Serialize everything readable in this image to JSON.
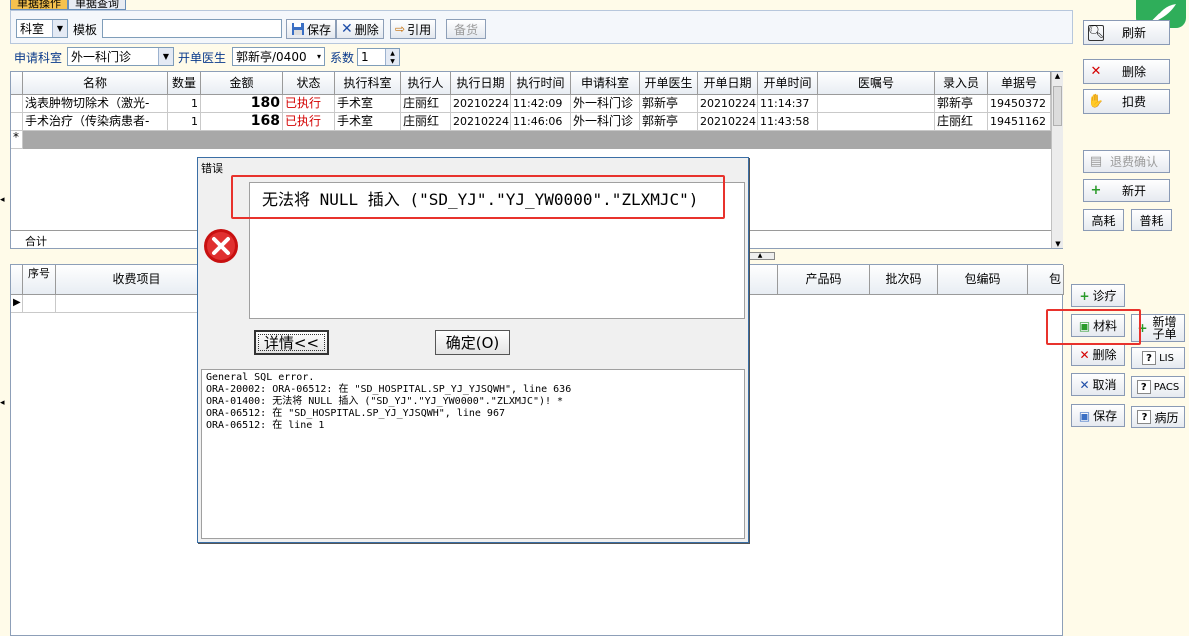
{
  "tabs": [
    "单据操作",
    "单据查询"
  ],
  "toolbar": {
    "dept_select": "科室",
    "template_label": "模板",
    "template_value": "",
    "save": "保存",
    "delete": "删除",
    "cite": "引用",
    "stock": "备货"
  },
  "filter": {
    "apply_dept_label": "申请科室",
    "apply_dept_value": "外一科门诊",
    "doctor_label": "开单医生",
    "doctor_value": "郭新亭/0400",
    "coef_label": "系数",
    "coef_value": "1"
  },
  "grid": {
    "columns": [
      "名称",
      "数量",
      "金额",
      "状态",
      "执行科室",
      "执行人",
      "执行日期",
      "执行时间",
      "申请科室",
      "开单医生",
      "开单日期",
      "开单时间",
      "医嘱号",
      "录入员",
      "单据号"
    ],
    "rows": [
      [
        "浅表肿物切除术（激光-",
        "1",
        "180",
        "已执行",
        "手术室",
        "庄丽红",
        "20210224",
        "11:42:09",
        "外一科门诊",
        "郭新亭",
        "20210224",
        "11:14:37",
        "",
        "郭新亭",
        "19450372"
      ],
      [
        "手术治疗（传染病患者-",
        "1",
        "168",
        "已执行",
        "手术室",
        "庄丽红",
        "20210224",
        "11:46:06",
        "外一科门诊",
        "郭新亭",
        "20210224",
        "11:43:58",
        "",
        "庄丽红",
        "19451162"
      ]
    ],
    "new_row_marker": "*",
    "total_label": "合计"
  },
  "lower_grid": {
    "columns": [
      "序号",
      "收费项目",
      "产品码",
      "批次码",
      "包编码",
      "包"
    ]
  },
  "right_panel": {
    "refresh": "刷新",
    "delete": "删除",
    "deduct": "扣费",
    "refund_confirm": "退费确认",
    "new_open": "新开",
    "high_cons": "高耗",
    "normal_cons": "普耗"
  },
  "right_panel2": {
    "treat": "诊疗",
    "material": "材料",
    "new_sub": "新增子单",
    "delete": "删除",
    "lis": "LIS",
    "cancel": "取消",
    "pacs": "PACS",
    "save": "保存",
    "history": "病历"
  },
  "dialog": {
    "title": "错误",
    "message": "无法将 NULL 插入 (\"SD_YJ\".\"YJ_YW0000\".\"ZLXMJC\")",
    "details_button": "详情<<",
    "ok_button": "确定(O)",
    "details_text": "General SQL error.\nORA-20002: ORA-06512: 在 \"SD_HOSPITAL.SP_YJ_YJSQWH\", line 636\nORA-01400: 无法将 NULL 插入 (\"SD_YJ\".\"YJ_YW0000\".\"ZLXMJC\")! *\nORA-06512: 在 \"SD_HOSPITAL.SP_YJ_YJSQWH\", line 967\nORA-06512: 在 line 1"
  },
  "colors": {
    "accent": "#f6c24d",
    "status_red": "#d40000",
    "highlight": "#e8322c",
    "brand": "#2fae5a"
  }
}
